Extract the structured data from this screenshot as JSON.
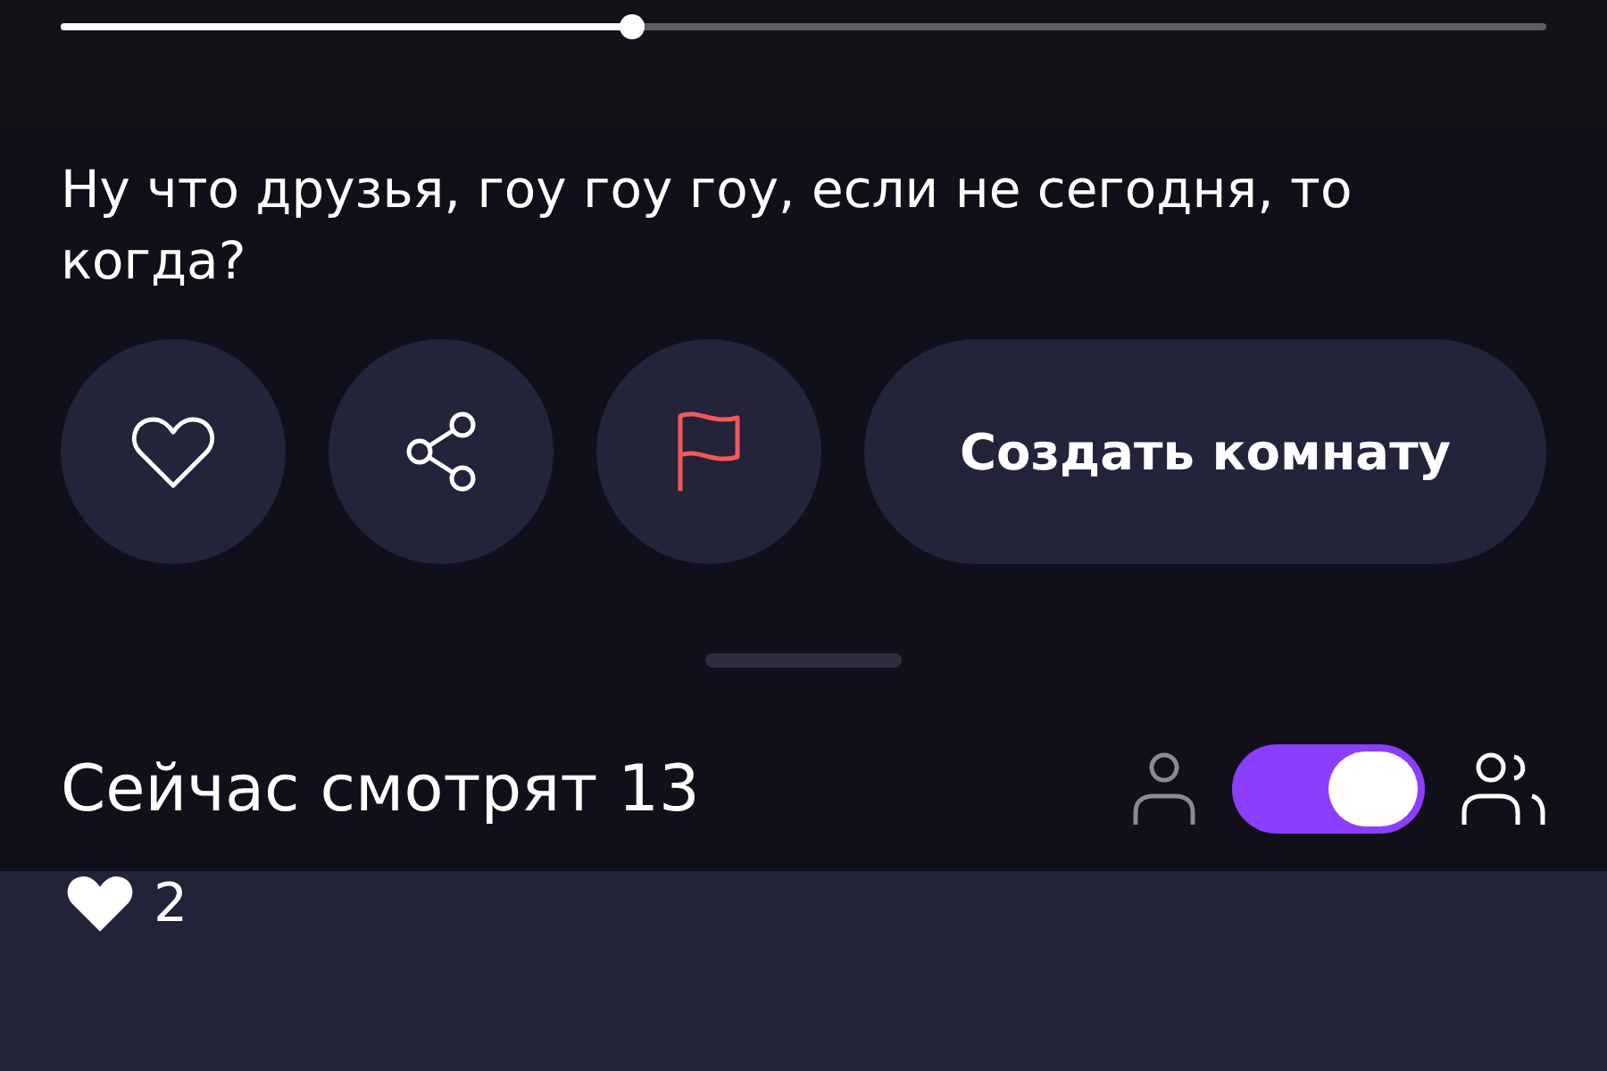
{
  "player": {
    "level": 0.385
  },
  "message": "Ну что друзья, гоу гоу гоу, если не сегодня, то когда?",
  "actions": [
    {
      "kind": "like"
    },
    {
      "kind": "share"
    },
    {
      "kind": "report"
    }
  ],
  "create_room_button": "Создать комнату",
  "viewers": {
    "title": "Сейчас смотрят 13",
    "group_mode": {
      "on": true
    }
  },
  "reactions": [
    {
      "count": "2"
    }
  ]
}
